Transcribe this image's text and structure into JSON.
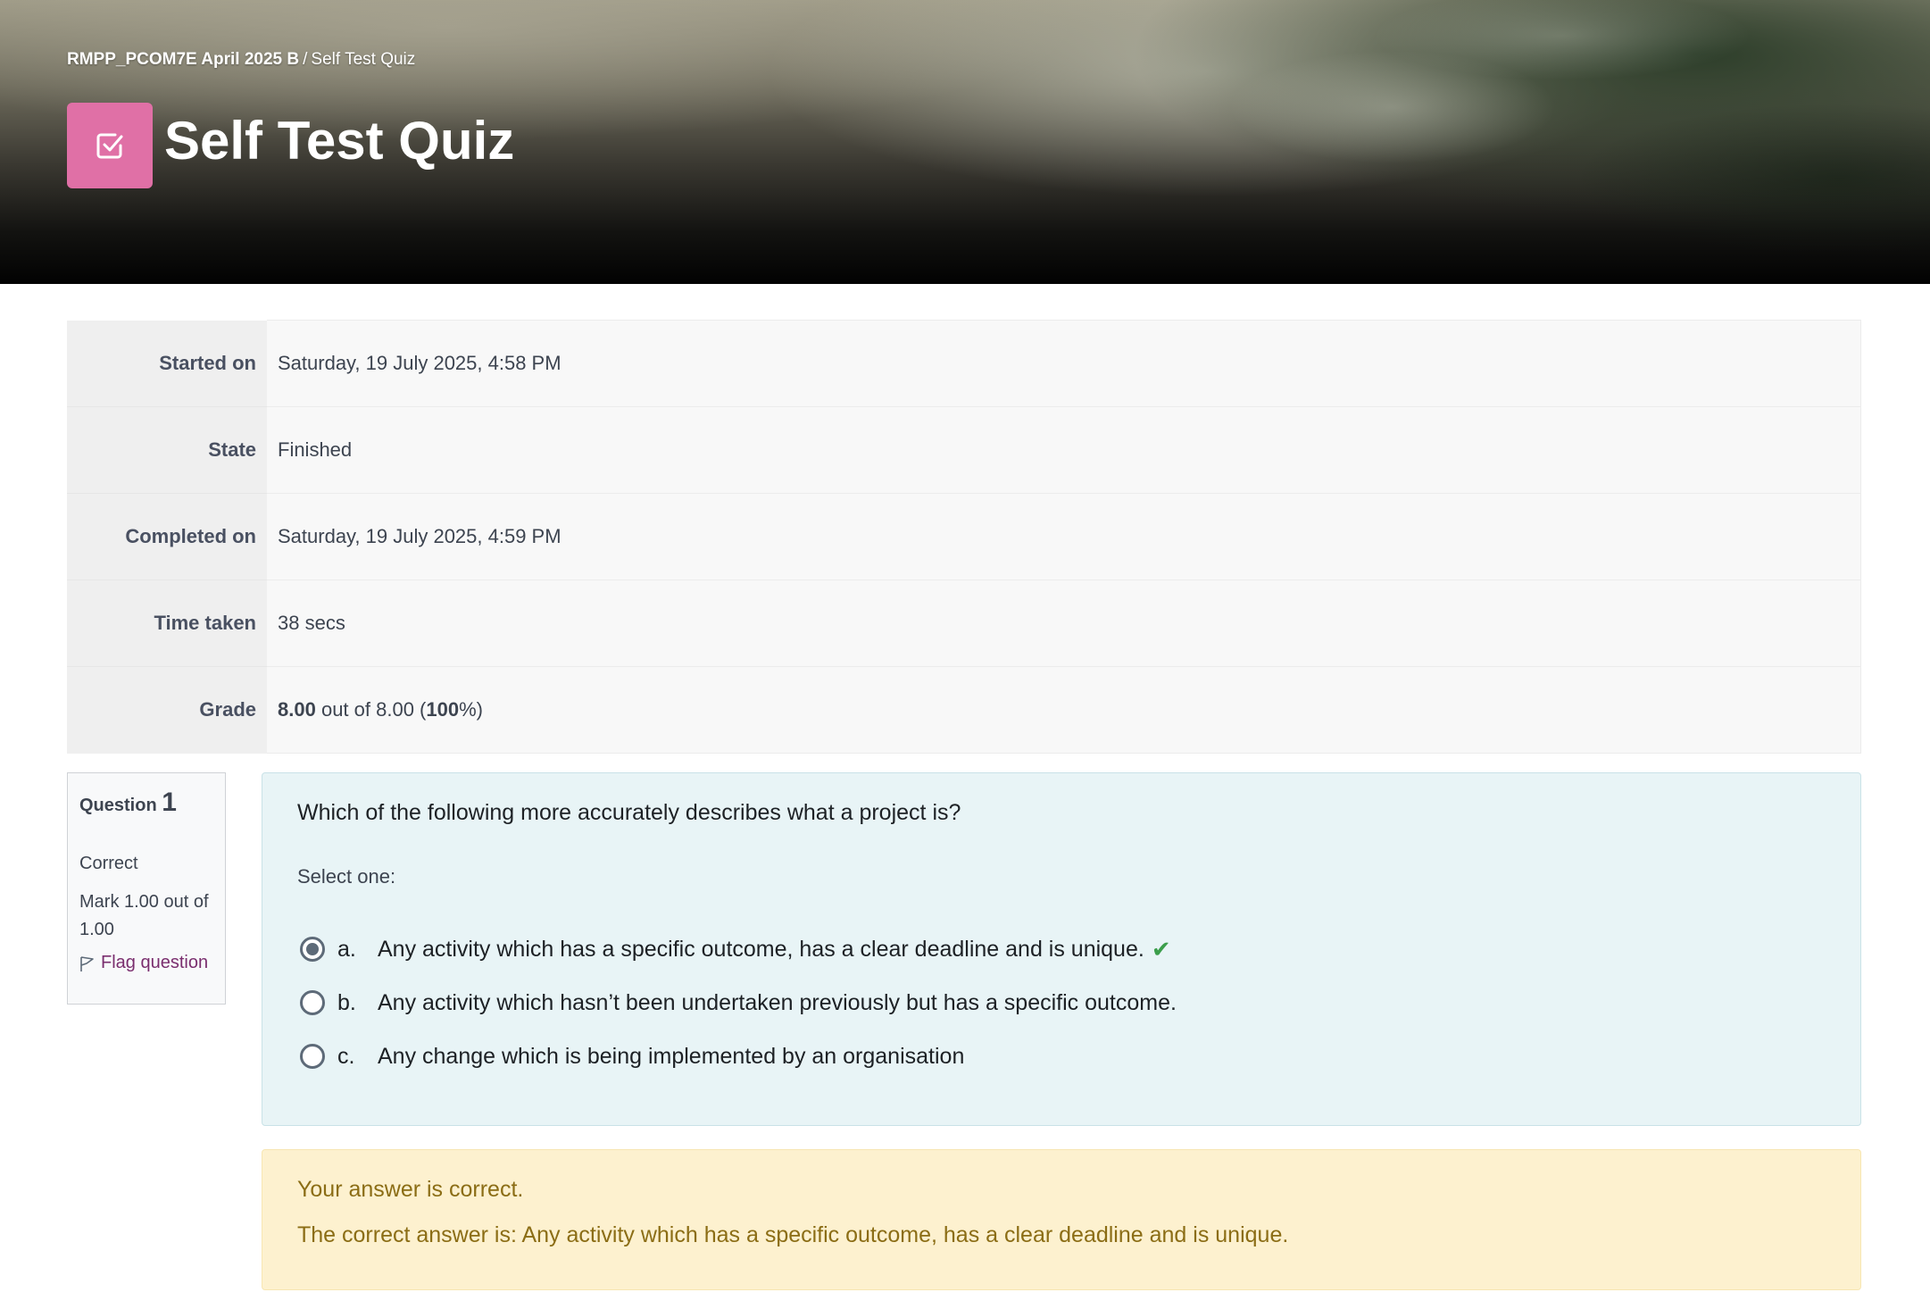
{
  "breadcrumb": {
    "course": "RMPP_PCOM7E April 2025 B",
    "separator": "/",
    "current": "Self Test Quiz"
  },
  "header": {
    "title": "Self Test Quiz",
    "icon": "quiz-checkbox-icon",
    "icon_color": "#e070a6"
  },
  "summary": {
    "rows": [
      {
        "label": "Started on",
        "value": "Saturday, 19 July 2025, 4:58 PM"
      },
      {
        "label": "State",
        "value": "Finished"
      },
      {
        "label": "Completed on",
        "value": "Saturday, 19 July 2025, 4:59 PM"
      },
      {
        "label": "Time taken",
        "value": "38 secs"
      }
    ],
    "grade": {
      "label": "Grade",
      "score": "8.00",
      "out_of": "out of 8.00 (",
      "percent": "100",
      "percent_suffix": "%)"
    }
  },
  "question": {
    "label": "Question",
    "number": "1",
    "state": "Correct",
    "mark": "Mark 1.00 out of 1.00",
    "flag_label": "Flag question",
    "text": "Which of the following more accurately describes what a project is?",
    "prompt": "Select one:",
    "answers": [
      {
        "letter": "a.",
        "text": "Any activity which has a specific outcome, has a clear deadline and is unique.",
        "selected": true,
        "correct": true
      },
      {
        "letter": "b.",
        "text": "Any activity which hasn’t been undertaken previously but has a specific outcome.",
        "selected": false
      },
      {
        "letter": "c.",
        "text": "Any change which is being implemented by an organisation",
        "selected": false
      }
    ]
  },
  "feedback": {
    "result": "Your answer is correct.",
    "correct_answer": "The correct answer is: Any activity which has a specific outcome, has a clear deadline and is unique."
  },
  "colors": {
    "question_bg": "#e8f4f6",
    "feedback_bg": "#fdf1cf",
    "correct_check": "#3b9e4b",
    "flag_link": "#7a2e6e"
  }
}
